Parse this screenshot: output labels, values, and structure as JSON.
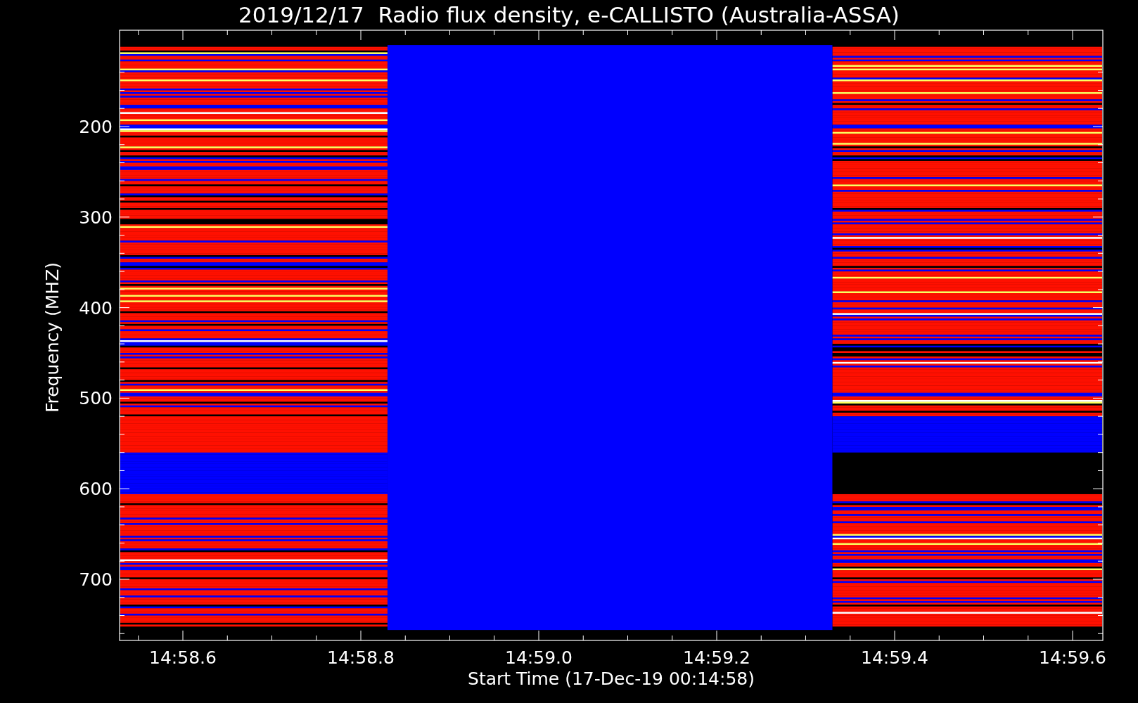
{
  "title": "2019/12/17  Radio flux density, e-CALLISTO (Australia-ASSA)",
  "plot": {
    "ylabel": "Frequency (MHZ)",
    "xlabel": "Start Time (17-Dec-19 00:14:58)",
    "yticks": [
      "200",
      "300",
      "400",
      "500",
      "600",
      "700"
    ],
    "xticks": [
      "14:58.6",
      "14:58.8",
      "14:59.0",
      "14:59.2",
      "14:59.4",
      "14:59.6"
    ]
  }
}
